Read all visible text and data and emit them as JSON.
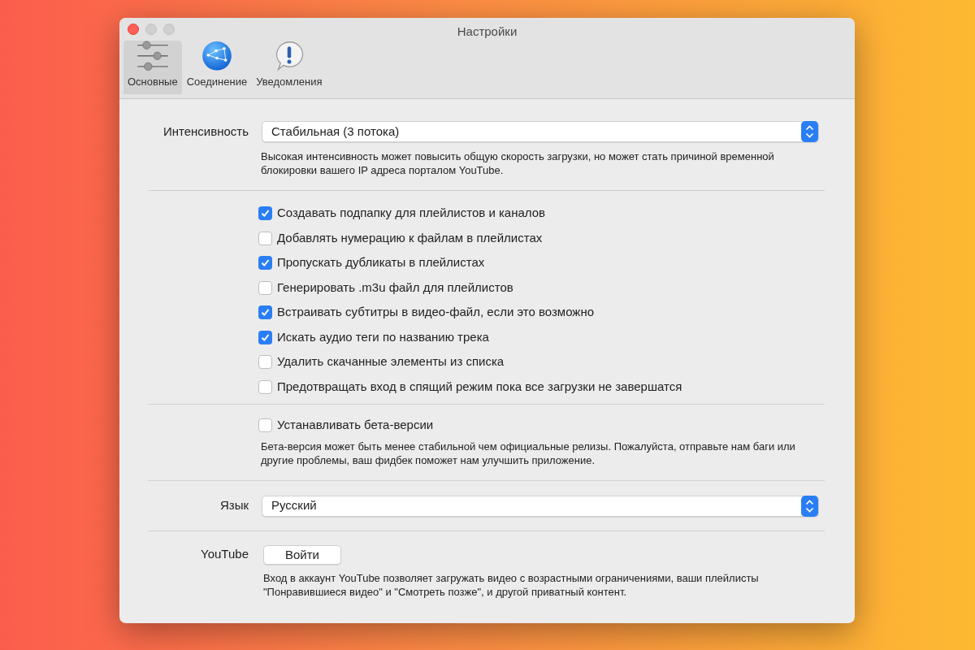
{
  "window": {
    "title": "Настройки"
  },
  "tabs": [
    {
      "label": "Основные",
      "selected": true,
      "kind": "sliders"
    },
    {
      "label": "Соединение",
      "selected": false,
      "kind": "globe"
    },
    {
      "label": "Уведомления",
      "selected": false,
      "kind": "alert"
    }
  ],
  "intensity": {
    "label": "Интенсивность",
    "value": "Стабильная (3 потока)",
    "description": "Высокая интенсивность может повысить общую скорость загрузки, но может стать причиной временной блокировки вашего IP адреса порталом YouTube."
  },
  "options": [
    {
      "label": "Создавать подпапку для плейлистов и каналов",
      "checked": true
    },
    {
      "label": "Добавлять нумерацию к файлам в плейлистах",
      "checked": false
    },
    {
      "label": "Пропускать дубликаты в плейлистах",
      "checked": true
    },
    {
      "label": "Генерировать .m3u файл для плейлистов",
      "checked": false
    },
    {
      "label": "Встраивать субтитры в видео-файл, если это возможно",
      "checked": true
    },
    {
      "label": "Искать аудио теги по названию трека",
      "checked": true
    },
    {
      "label": "Удалить скачанные элементы из списка",
      "checked": false
    },
    {
      "label": "Предотвращать вход в спящий режим пока все загрузки не завершатся",
      "checked": false
    }
  ],
  "beta": {
    "label": "Устанавливать бета-версии",
    "checked": false,
    "description": "Бета-версия может быть менее стабильной чем официальные релизы.  Пожалуйста, отправьте нам баги или другие проблемы, ваш фидбек поможет нам улучшить приложение."
  },
  "language": {
    "label": "Язык",
    "value": "Русский"
  },
  "youtube": {
    "label": "YouTube",
    "button": "Войти",
    "description": "Вход в аккаунт YouTube позволяет загружать видео с возрастными ограничениями, ваши плейлисты \"Понравившиеся видео\" и \"Смотреть позже\", и другой приватный контент."
  }
}
